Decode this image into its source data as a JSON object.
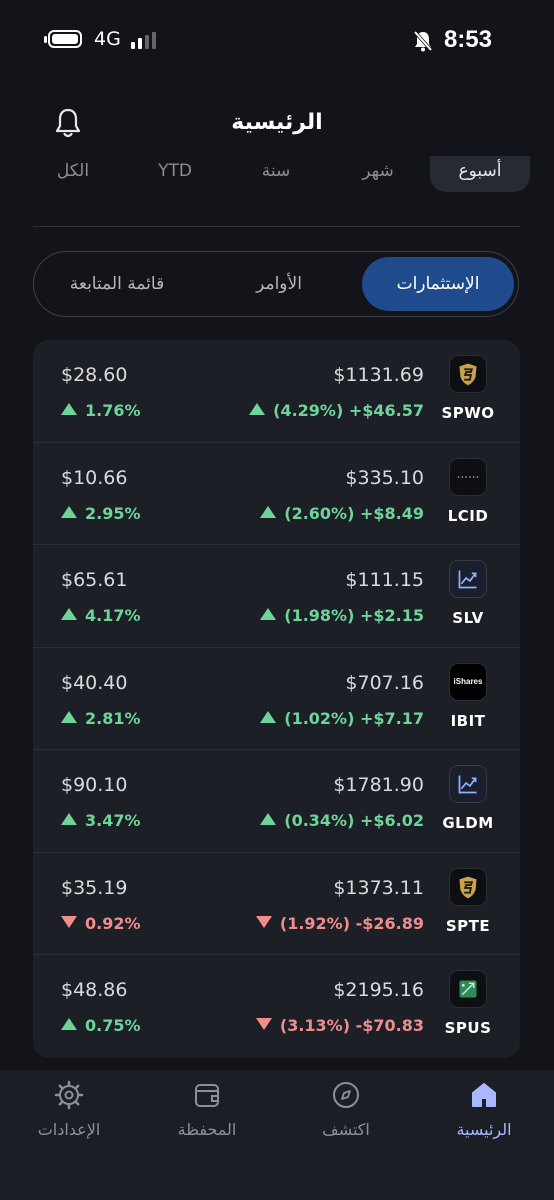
{
  "status_bar": {
    "time": "8:53",
    "network": "4G"
  },
  "header": {
    "title": "الرئيسية"
  },
  "periods": [
    {
      "label": "أسبوع",
      "active": true
    },
    {
      "label": "شهر",
      "active": false
    },
    {
      "label": "سنة",
      "active": false
    },
    {
      "label": "YTD",
      "active": false
    },
    {
      "label": "الكل",
      "active": false
    }
  ],
  "tabs": [
    {
      "label": "الإستثمارات",
      "active": true
    },
    {
      "label": "الأوامر",
      "active": false
    },
    {
      "label": "قائمة المتابعة",
      "active": false
    }
  ],
  "holdings": [
    {
      "ticker": "SPWO",
      "logo": "sp-funds-shield-icon",
      "total": "$1131.69",
      "gain": "+$46.57",
      "gain_pct": "(4.29%)",
      "gain_dir": "up",
      "price": "$28.60",
      "change_pct": "1.76%",
      "change_dir": "up"
    },
    {
      "ticker": "LCID",
      "logo": "lucid-logo-icon",
      "total": "$335.10",
      "gain": "+$8.49",
      "gain_pct": "(2.60%)",
      "gain_dir": "up",
      "price": "$10.66",
      "change_pct": "2.95%",
      "change_dir": "up"
    },
    {
      "ticker": "SLV",
      "logo": "chart-trend-icon",
      "total": "$111.15",
      "gain": "+$2.15",
      "gain_pct": "(1.98%)",
      "gain_dir": "up",
      "price": "$65.61",
      "change_pct": "4.17%",
      "change_dir": "up"
    },
    {
      "ticker": "IBIT",
      "logo": "ishares-logo-icon",
      "logo_text": "iShares",
      "total": "$707.16",
      "gain": "+$7.17",
      "gain_pct": "(1.02%)",
      "gain_dir": "up",
      "price": "$40.40",
      "change_pct": "2.81%",
      "change_dir": "up"
    },
    {
      "ticker": "GLDM",
      "logo": "chart-trend-icon",
      "total": "$1781.90",
      "gain": "+$6.02",
      "gain_pct": "(0.34%)",
      "gain_dir": "up",
      "price": "$90.10",
      "change_pct": "3.47%",
      "change_dir": "up"
    },
    {
      "ticker": "SPTE",
      "logo": "sp-funds-shield-icon",
      "total": "$1373.11",
      "gain": "-$26.89",
      "gain_pct": "(1.92%)",
      "gain_dir": "down",
      "price": "$35.19",
      "change_pct": "0.92%",
      "change_dir": "down"
    },
    {
      "ticker": "SPUS",
      "logo": "sp-funds-green-icon",
      "total": "$2195.16",
      "gain": "-$70.83",
      "gain_pct": "(3.13%)",
      "gain_dir": "down",
      "price": "$48.86",
      "change_pct": "0.75%",
      "change_dir": "up"
    }
  ],
  "bottom_nav": [
    {
      "label": "الرئيسية",
      "icon": "home-icon",
      "active": true
    },
    {
      "label": "اكتشف",
      "icon": "compass-icon",
      "active": false
    },
    {
      "label": "المحفظة",
      "icon": "wallet-icon",
      "active": false
    },
    {
      "label": "الإعدادات",
      "icon": "gear-icon",
      "active": false
    }
  ],
  "colors": {
    "positive": "#6fd49a",
    "negative": "#f08c8c",
    "accent": "#1f4b8c",
    "nav_active": "#a9b8ff"
  }
}
